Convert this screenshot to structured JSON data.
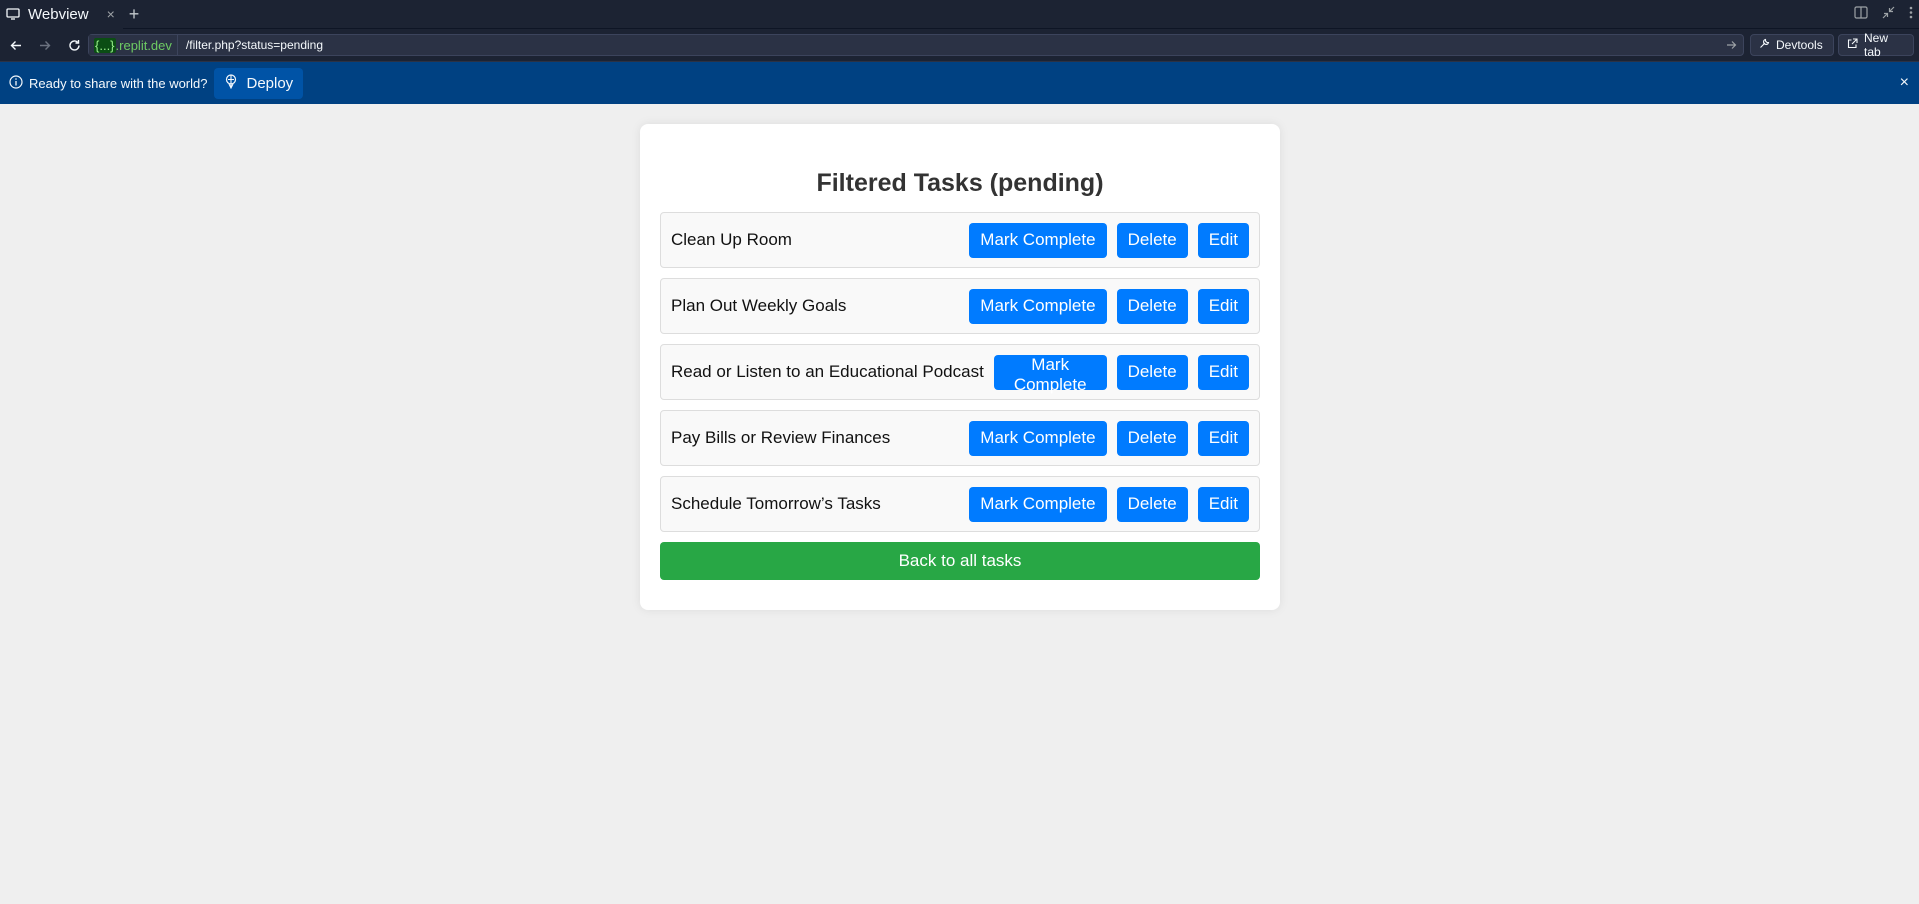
{
  "browser": {
    "tab_title": "Webview",
    "tab_close": "×",
    "new_tab": "+",
    "url_host_braces": "{...}",
    "url_host_domain": ".replit.dev",
    "url_path": "/filter.php?status=pending",
    "devtools_label": "Devtools",
    "newtab_label": "New tab"
  },
  "banner": {
    "message": "Ready to share with the world?",
    "deploy_label": "Deploy",
    "close": "×"
  },
  "page": {
    "title": "Filtered Tasks (pending)",
    "tasks": [
      {
        "title": "Clean Up Room"
      },
      {
        "title": "Plan Out Weekly Goals"
      },
      {
        "title": "Read or Listen to an Educational Podcast"
      },
      {
        "title": "Pay Bills or Review Finances"
      },
      {
        "title": "Schedule Tomorrow’s Tasks"
      }
    ],
    "actions": {
      "complete": "Mark Complete",
      "delete": "Delete",
      "edit": "Edit"
    },
    "back_label": "Back to all tasks"
  },
  "colors": {
    "primary": "#007bff",
    "success": "#28a745",
    "chrome_bg": "#1c2333",
    "banner_bg": "#004182"
  }
}
